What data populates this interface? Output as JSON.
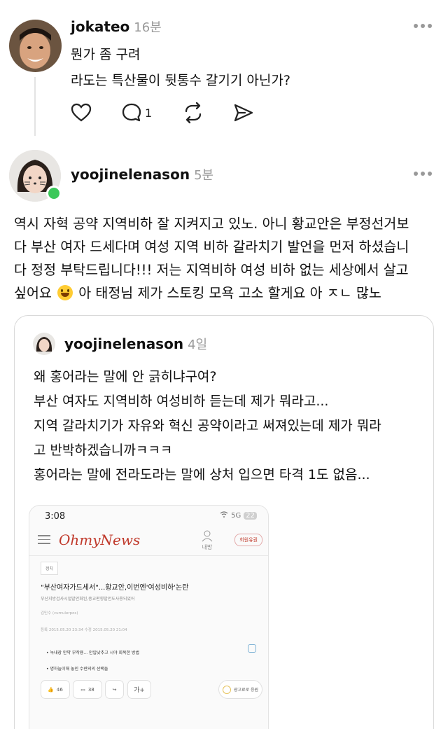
{
  "post1": {
    "username": "jokateo",
    "time": "16분",
    "lines": [
      "뭔가 좀 구려",
      "라도는 특산물이 뒷통수 갈기기 아닌가?"
    ],
    "actions": {
      "reply_count": "1"
    }
  },
  "post2": {
    "username": "yoojinelenason",
    "time": "5분",
    "lines": [
      "역시 자혁 공약 지역비하 잘 지켜지고 있노. 아니 황교안은 부정선거보",
      "다 부산 여자 드세다며 여성 지역 비하 갈라치기 발언을 먼저 하셨습니",
      "다 정정 부탁드립니다!!! 저는 지역비하 여성 비하 없는 세상에서 살고",
      "싶어요",
      "아 태정님 제가 스토킹 모욕 고소 할게요 아 ㅈㄴ 많노"
    ],
    "emoji": "grinning-face"
  },
  "quote": {
    "username": "yoojinelenason",
    "time": "4일",
    "lines": [
      "왜 홍어라는 말에 안 긁히냐구여?",
      "부산 여자도 지역비하 여성비하 듣는데 제가 뭐라고...",
      "지역 갈라치기가 자유와 혁신 공약이라고 써져있는데 제가 뭐라",
      "고 반박하겠습니까ㅋㅋㅋ",
      "홍어라는 말에 전라도라는 말에 상처 입으면 타격 1도 없음..."
    ]
  },
  "screenshot": {
    "time": "3:08",
    "status": "5G",
    "battery": "22",
    "logo": "OhmyNews",
    "user_label": "내방",
    "join_label": "회원유권",
    "tag": "정치",
    "title": "\"부산여자가드세서\"...황교안,이번엔'여성비하'논란",
    "subtitle": "부산지방검사시절발언화된,종교편향발언도사용되었어",
    "author": "김민수 (cumulerpos)",
    "date": "등록 2015.05.20 23:34   수정 2015.05.20 21:04",
    "related": [
      "녹내장 안약 부작용... 안압낮추고 시야 회복한 방법",
      "명하늘이해 놓인 수련의의 선택들"
    ],
    "like_count": "46",
    "comment_count": "38",
    "font_label": "가+",
    "ad_label": "광고료로 응원"
  },
  "colors": {
    "online": "#3cc85a",
    "muted": "#9a9a9a",
    "brand_red": "#c0392b"
  }
}
